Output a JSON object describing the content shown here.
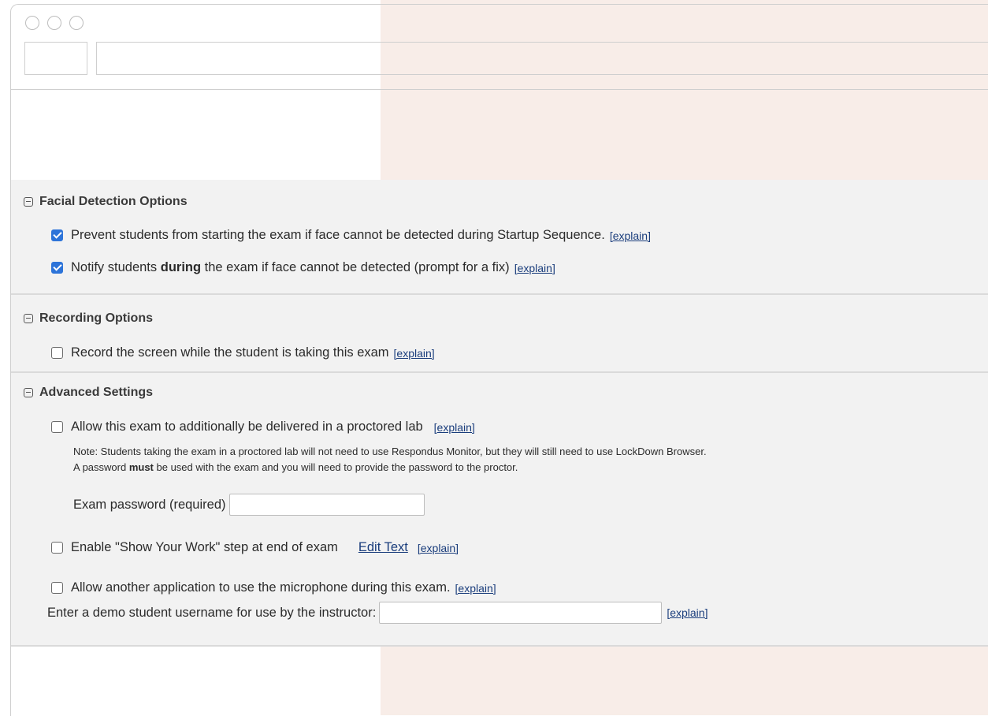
{
  "facial": {
    "title": "Facial Detection Options",
    "opt1_label": "Prevent students from starting the exam if face cannot be detected during Startup Sequence.",
    "opt1_checked": true,
    "opt2_label_pre": "Notify students ",
    "opt2_label_bold": "during",
    "opt2_label_post": " the exam if face cannot be detected (prompt for a fix)",
    "opt2_checked": true
  },
  "recording": {
    "title": "Recording Options",
    "opt1_label": "Record the screen while the student is taking this exam",
    "opt1_checked": false
  },
  "advanced": {
    "title": "Advanced Settings",
    "lab_label": "Allow this exam to additionally be delivered in a proctored lab",
    "lab_checked": false,
    "note_line1": "Note: Students taking the exam in a proctored lab will not need to use Respondus Monitor, but they will still need to use LockDown Browser.",
    "note_line2_pre": "A password ",
    "note_line2_bold": "must",
    "note_line2_post": " be used with the exam and you will need to provide the password to the proctor.",
    "password_label": "Exam password (required)",
    "password_value": "",
    "show_work_label": "Enable \"Show Your Work\" step at end of exam",
    "show_work_checked": false,
    "edit_text": "Edit Text",
    "microphone_label": "Allow another application to use the microphone during this exam.",
    "microphone_checked": false,
    "demo_label": "Enter a demo student username for use by the instructor:",
    "demo_value": ""
  },
  "explain_link": "[explain]"
}
